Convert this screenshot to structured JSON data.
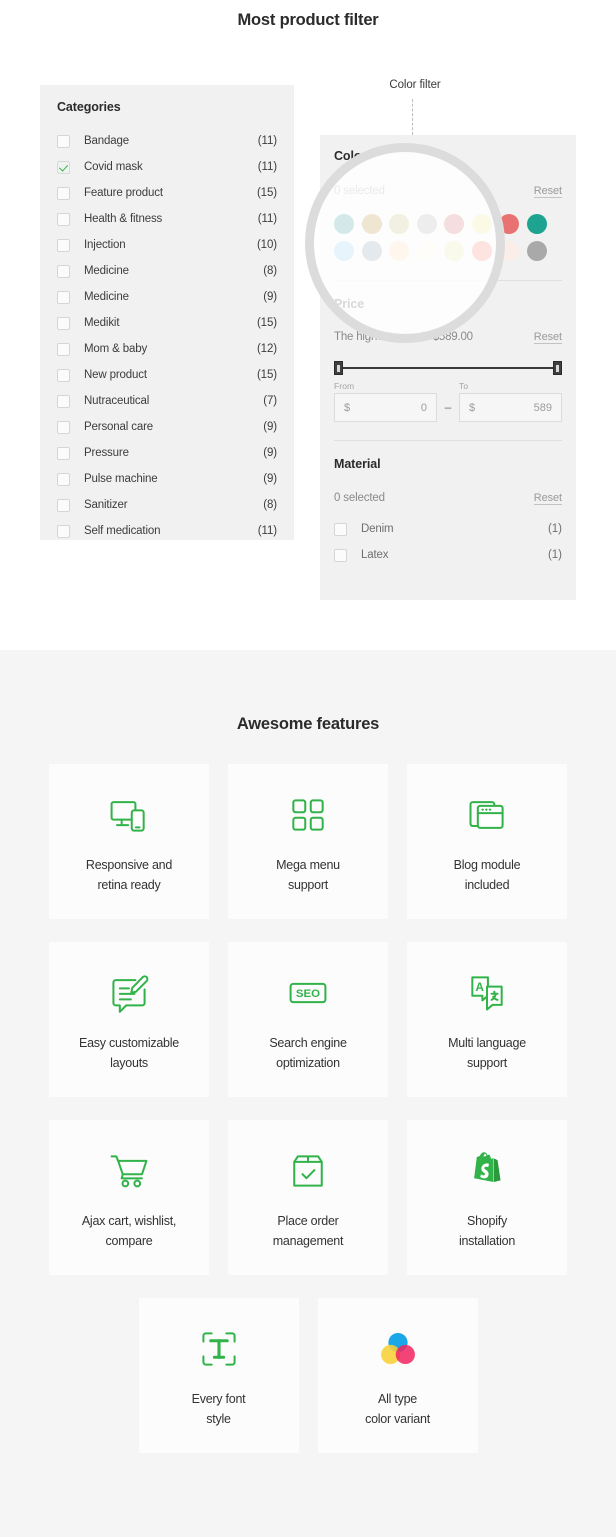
{
  "filter_section": {
    "title": "Most product filter",
    "callout": {
      "label": "Color filter"
    },
    "categories_panel": {
      "heading": "Categories",
      "items": [
        {
          "label": "Bandage",
          "count": "(11)",
          "checked": false
        },
        {
          "label": "Covid mask",
          "count": "(11)",
          "checked": true
        },
        {
          "label": "Feature product",
          "count": "(15)",
          "checked": false
        },
        {
          "label": "Health & fitness",
          "count": "(11)",
          "checked": false
        },
        {
          "label": "Injection",
          "count": "(10)",
          "checked": false
        },
        {
          "label": "Medicine",
          "count": "(8)",
          "checked": false
        },
        {
          "label": "Medicine",
          "count": "(9)",
          "checked": false
        },
        {
          "label": "Medikit",
          "count": "(15)",
          "checked": false
        },
        {
          "label": "Mom & baby",
          "count": "(12)",
          "checked": false
        },
        {
          "label": "New product",
          "count": "(15)",
          "checked": false
        },
        {
          "label": "Nutraceutical",
          "count": "(7)",
          "checked": false
        },
        {
          "label": "Personal care",
          "count": "(9)",
          "checked": false
        },
        {
          "label": "Pressure",
          "count": "(9)",
          "checked": false
        },
        {
          "label": "Pulse machine",
          "count": "(9)",
          "checked": false
        },
        {
          "label": "Sanitizer",
          "count": "(8)",
          "checked": false
        },
        {
          "label": "Self medication",
          "count": "(11)",
          "checked": false
        }
      ]
    },
    "color_block": {
      "heading": "Color",
      "selected_text": "0 selected",
      "reset_label": "Reset",
      "swatches": [
        "#0b8080",
        "#a87503",
        "#b5b35c",
        "#9a9a9a",
        "#c14c4c",
        "#ece27c",
        "#e87272",
        "#1ea391",
        "#7fc0ea",
        "#6c859b",
        "#fbd399",
        "#fbf5e3",
        "#dde08e",
        "#f56a55",
        "#fbeee9",
        "#a9a9a9"
      ]
    },
    "price_block": {
      "heading": "Price",
      "note": "The highest price is $589.00",
      "reset_label": "Reset",
      "from_label": "From",
      "to_label": "To",
      "currency": "$",
      "from_value": "0",
      "to_value": "589"
    },
    "material_block": {
      "heading": "Material",
      "selected_text": "0 selected",
      "reset_label": "Reset",
      "items": [
        {
          "label": "Denim",
          "count": "(1)"
        },
        {
          "label": "Latex",
          "count": "(1)"
        }
      ]
    }
  },
  "features_section": {
    "title": "Awesome features",
    "accent": "#32b34a",
    "cards": [
      {
        "icon": "responsive-devices-icon",
        "caption": "Responsive and\nretina ready"
      },
      {
        "icon": "mega-menu-grid-icon",
        "caption": "Mega menu\nsupport"
      },
      {
        "icon": "blog-module-icon",
        "caption": "Blog module\nincluded"
      },
      {
        "icon": "edit-layout-icon",
        "caption": "Easy customizable\nlayouts"
      },
      {
        "icon": "seo-badge-icon",
        "caption": "Search engine\noptimization"
      },
      {
        "icon": "translate-language-icon",
        "caption": "Multi language\nsupport"
      },
      {
        "icon": "shopping-cart-icon",
        "caption": "Ajax cart, wishlist,\ncompare"
      },
      {
        "icon": "package-check-icon",
        "caption": "Place order\nmanagement"
      },
      {
        "icon": "shopify-bag-icon",
        "caption": "Shopify\ninstallation"
      },
      {
        "icon": "font-style-icon",
        "caption": "Every font\nstyle"
      },
      {
        "icon": "color-variant-circles-icon",
        "caption": "All type\ncolor variant"
      }
    ]
  }
}
